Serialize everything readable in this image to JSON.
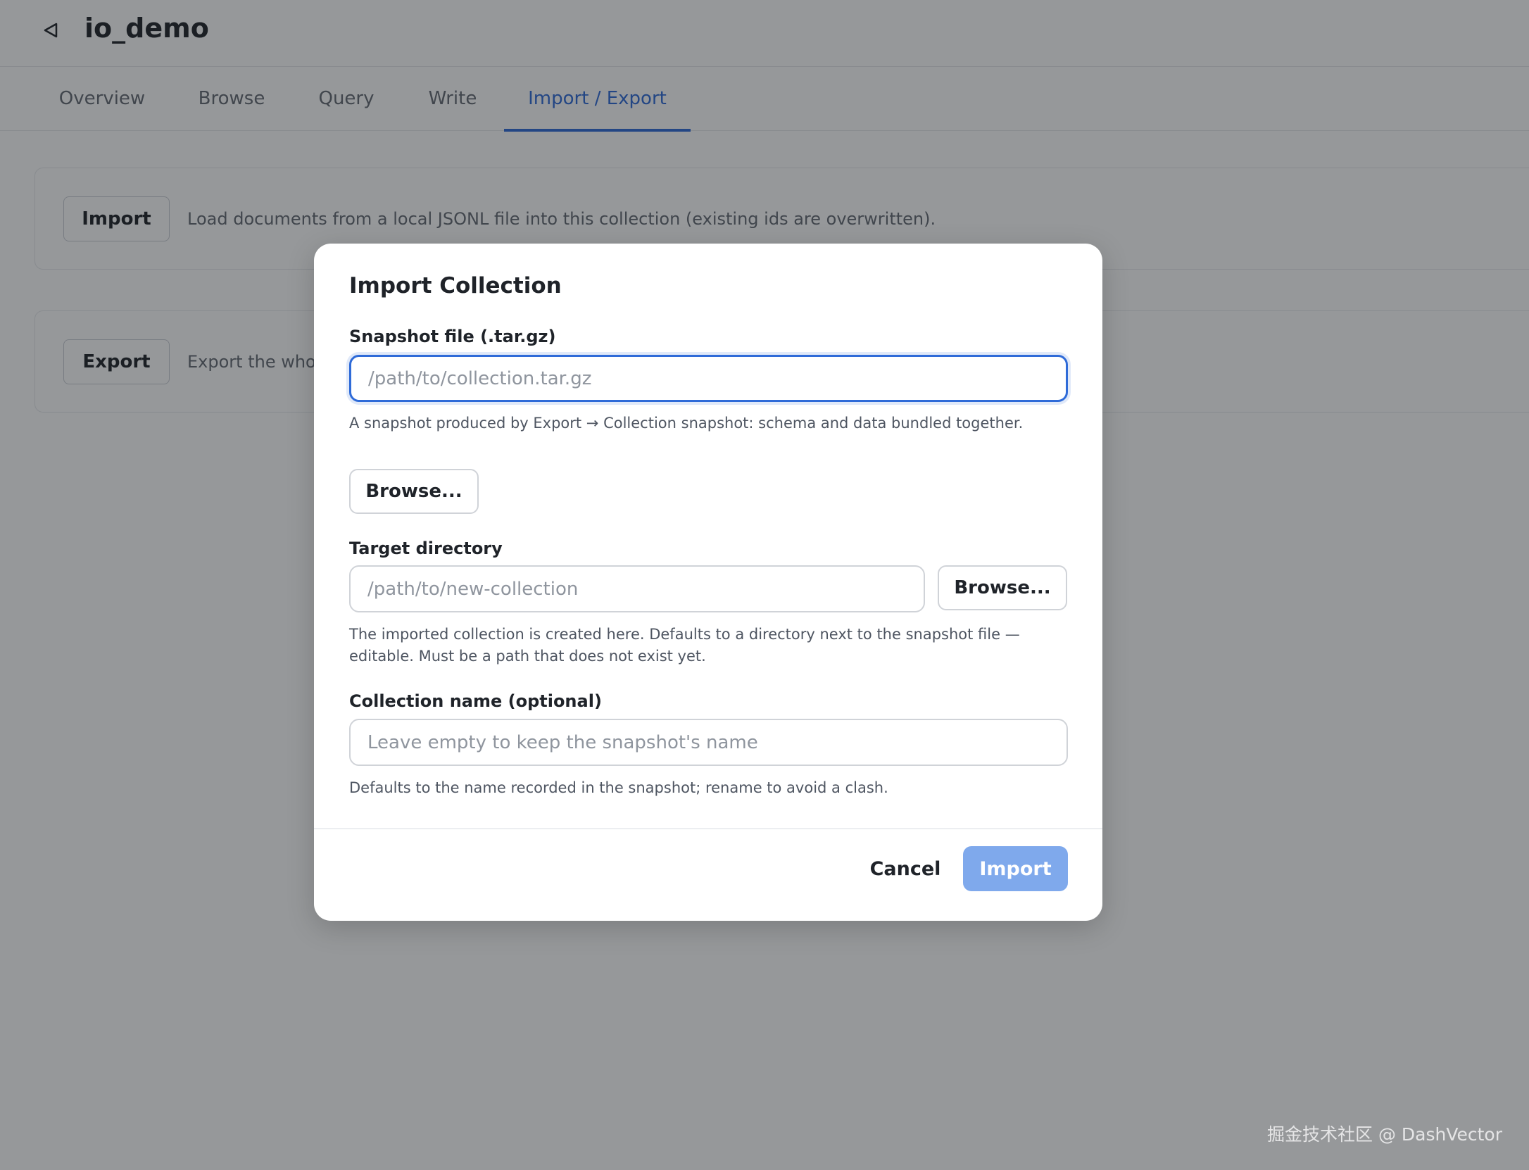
{
  "header": {
    "title": "io_demo",
    "back_icon": "back-triangle-icon"
  },
  "tabs": [
    {
      "label": "Overview",
      "active": false
    },
    {
      "label": "Browse",
      "active": false
    },
    {
      "label": "Query",
      "active": false
    },
    {
      "label": "Write",
      "active": false
    },
    {
      "label": "Import / Export",
      "active": true
    }
  ],
  "cards": {
    "import": {
      "button_label": "Import",
      "description": "Load documents from a local JSONL file into this collection (existing ids are overwritten)."
    },
    "export": {
      "button_label": "Export",
      "description": "Export the whole"
    }
  },
  "modal": {
    "title": "Import Collection",
    "snapshot": {
      "label": "Snapshot file (.tar.gz)",
      "value": "",
      "placeholder": "/path/to/collection.tar.gz",
      "hint": "A snapshot produced by Export → Collection snapshot: schema and data bundled together.",
      "browse_label": "Browse..."
    },
    "target": {
      "label": "Target directory",
      "value": "",
      "placeholder": "/path/to/new-collection",
      "hint": "The imported collection is created here. Defaults to a directory next to the snapshot file — editable. Must be a path that does not exist yet.",
      "browse_label": "Browse..."
    },
    "name": {
      "label": "Collection name (optional)",
      "value": "",
      "placeholder": "Leave empty to keep the snapshot's name",
      "hint": "Defaults to the name recorded in the snapshot; rename to avoid a clash."
    },
    "cancel_label": "Cancel",
    "import_label": "Import"
  },
  "colors": {
    "accent": "#2f6bd8",
    "import_disabled": "#7fa9ec",
    "overlay": "rgba(23,26,31,0.45)"
  },
  "watermark": "掘金技术社区 @ DashVector"
}
